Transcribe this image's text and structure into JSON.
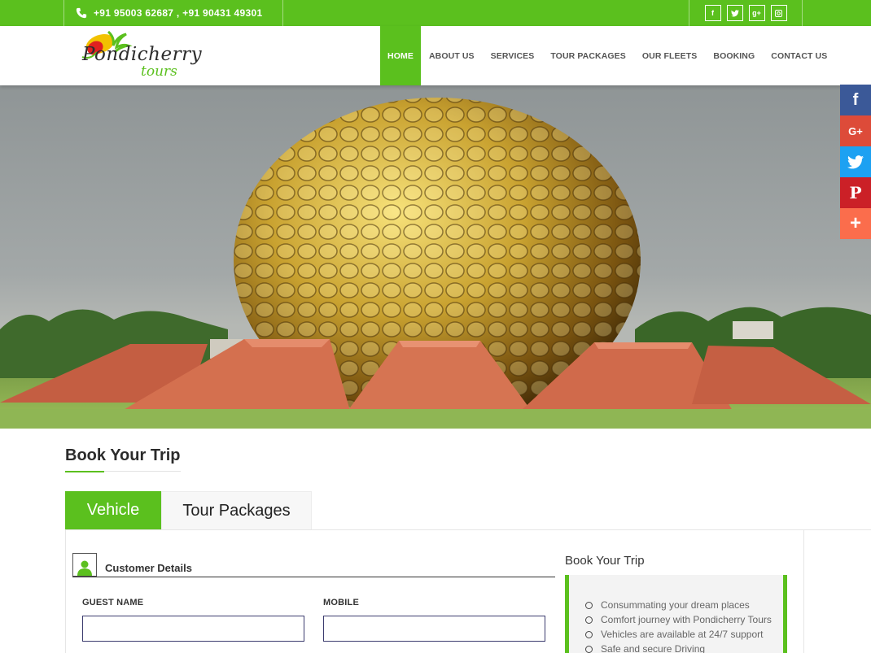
{
  "topbar": {
    "phone": "+91 95003 62687 , +91 90431 49301",
    "social_icons": [
      "facebook-icon",
      "twitter-icon",
      "google-plus-icon",
      "instagram-icon"
    ]
  },
  "logo": {
    "line1": "Pondicherry",
    "line2": "tours"
  },
  "nav": {
    "items": [
      "HOME",
      "ABOUT US",
      "SERVICES",
      "TOUR PACKAGES",
      "OUR FLEETS",
      "BOOKING",
      "CONTACT US"
    ]
  },
  "share_bar": {
    "facebook": "f",
    "google": "G+",
    "twitter": "twitter-bird-icon",
    "pinterest": "P",
    "more": "+"
  },
  "booking": {
    "title": "Book Your Trip",
    "tabs": [
      "Vehicle",
      "Tour Packages"
    ],
    "customer_details": "Customer Details",
    "guest_name_label": "GUEST NAME",
    "mobile_label": "MOBILE",
    "guest_name_value": "",
    "mobile_value": ""
  },
  "sidebar": {
    "title": "Book Your Trip",
    "items": [
      "Consummating your dream places",
      "Comfort journey with Pondicherry Tours",
      "Vehicles are available at 24/7 support",
      "Safe and secure Driving"
    ]
  },
  "colors": {
    "brand_green": "#5bc01e",
    "facebook": "#3b5998",
    "google": "#dd4b39",
    "twitter": "#1da1f2",
    "pinterest": "#cb2027",
    "more": "#fb6d4c"
  }
}
